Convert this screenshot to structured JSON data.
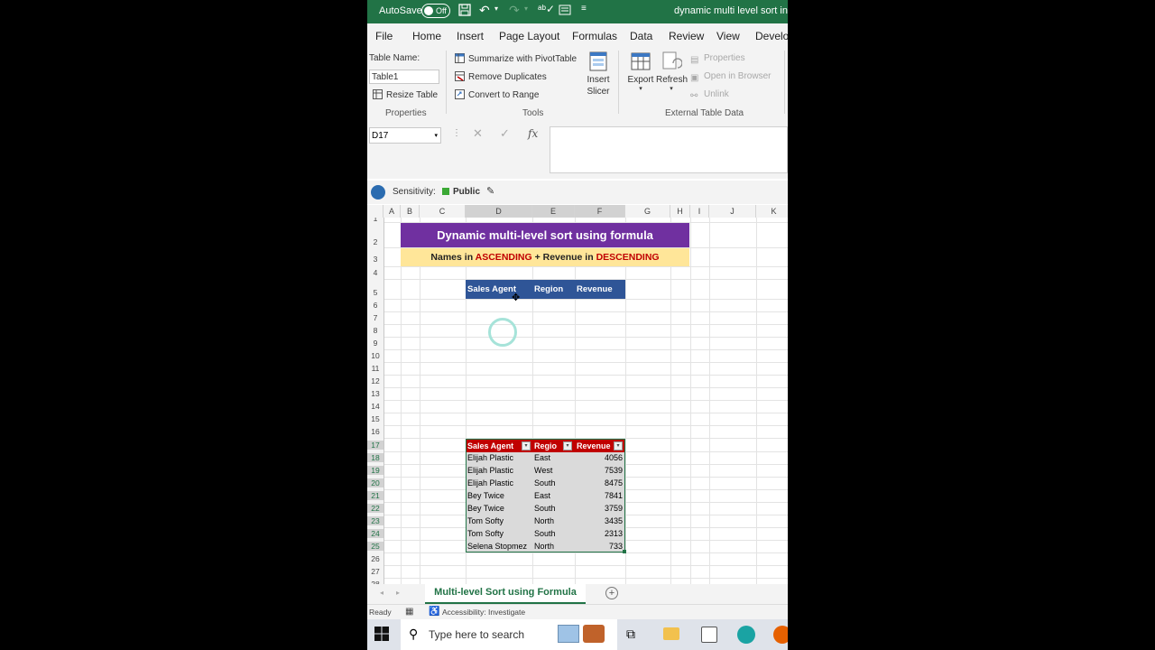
{
  "titlebar": {
    "autosave_label": "AutoSave",
    "toggle_state": "Off",
    "title": "dynamic multi level sort in ex"
  },
  "tabs": [
    "File",
    "Home",
    "Insert",
    "Page Layout",
    "Formulas",
    "Data",
    "Review",
    "View",
    "Develo"
  ],
  "ribbon": {
    "table_name_label": "Table Name:",
    "table_name_value": "Table1",
    "resize_table": "Resize Table",
    "properties_group": "Properties",
    "summarize": "Summarize with PivotTable",
    "remove_duplicates": "Remove Duplicates",
    "convert_to_range": "Convert to Range",
    "tools_group": "Tools",
    "insert_slicer_1": "Insert",
    "insert_slicer_2": "Slicer",
    "export": "Export",
    "refresh": "Refresh",
    "properties_btn": "Properties",
    "open_in_browser": "Open in Browser",
    "unlink": "Unlink",
    "external_group": "External Table Data"
  },
  "formula_bar": {
    "name_box": "D17",
    "fx": "fx",
    "value": ""
  },
  "sensitivity": {
    "label": "Sensitivity:",
    "value": "Public"
  },
  "columns": [
    "A",
    "B",
    "C",
    "D",
    "E",
    "F",
    "G",
    "H",
    "I",
    "J",
    "K"
  ],
  "rows": [
    "1",
    "2",
    "3",
    "4",
    "5",
    "6",
    "7",
    "8",
    "9",
    "10",
    "11",
    "12",
    "13",
    "14",
    "15",
    "16",
    "17",
    "18",
    "19",
    "20",
    "21",
    "22",
    "23",
    "24",
    "25",
    "26",
    "27",
    "28"
  ],
  "sheet": {
    "title": "Dynamic multi-level sort using formula",
    "subtitle_pre": "Names in ",
    "subtitle_asc": "ASCENDING",
    "subtitle_mid": " + Revenue in ",
    "subtitle_desc": "DESCENDING",
    "result_headers": [
      "Sales Agent",
      "Region",
      "Revenue"
    ],
    "table_headers": [
      "Sales Agent",
      "Regio",
      "Revenue"
    ],
    "table_rows": [
      [
        "Elijah Plastic",
        "East",
        "4056"
      ],
      [
        "Elijah Plastic",
        "West",
        "7539"
      ],
      [
        "Elijah Plastic",
        "South",
        "8475"
      ],
      [
        "Bey Twice",
        "East",
        "7841"
      ],
      [
        "Bey Twice",
        "South",
        "3759"
      ],
      [
        "Tom Softy",
        "North",
        "3435"
      ],
      [
        "Tom Softy",
        "South",
        "2313"
      ],
      [
        "Selena Stopmez",
        "North",
        "733"
      ]
    ]
  },
  "sheet_tab": "Multi-level Sort using Formula",
  "status": {
    "ready": "Ready",
    "accessibility": "Accessibility: Investigate"
  },
  "taskbar": {
    "search_placeholder": "Type here to search"
  },
  "colors": {
    "excel_green": "#217346",
    "title_purple": "#7030a0",
    "subtitle_yellow": "#ffe699",
    "header_blue": "#2f5597",
    "table_red": "#c00000"
  }
}
